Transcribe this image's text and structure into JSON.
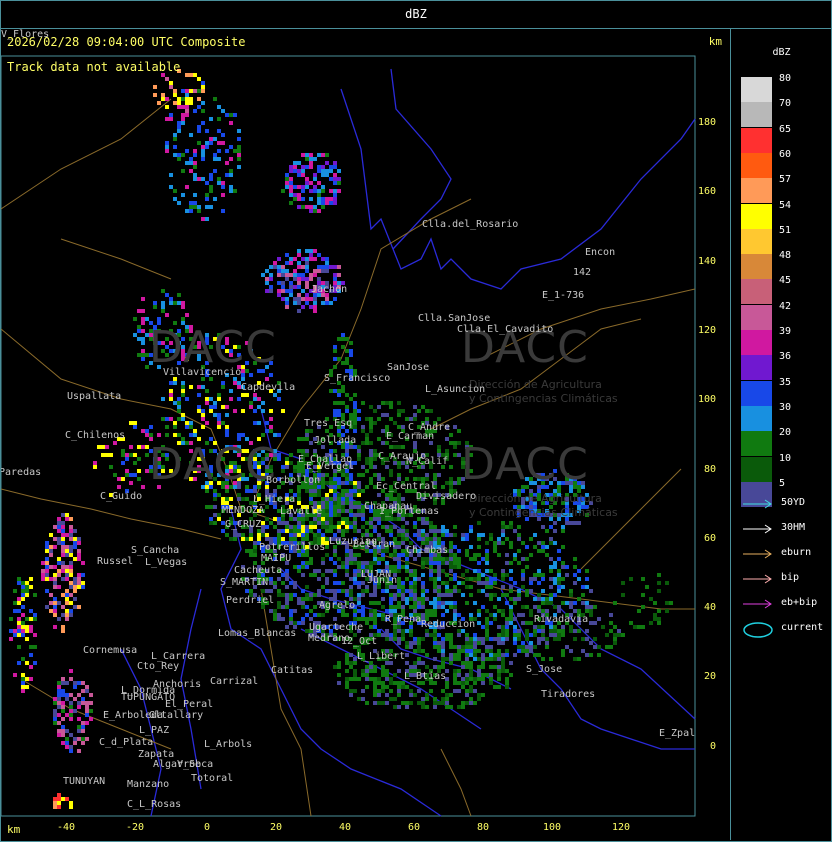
{
  "window": {
    "title": "dBZ"
  },
  "map": {
    "header": "2026/02/28 09:04:00 UTC Composite",
    "notice": "Track data not available",
    "km_label_top": "km",
    "km_label_bottom": "km",
    "y_ticks": [
      "180",
      "160",
      "140",
      "120",
      "100",
      "80",
      "60",
      "40",
      "20",
      "0"
    ],
    "x_ticks": [
      "-40",
      "-20",
      "0",
      "20",
      "40",
      "60",
      "80",
      "100",
      "120"
    ],
    "watermark_text": "DACC",
    "watermark_sub1": "Dirección de Agricultura",
    "watermark_sub2": "y Contingencias Climáticas",
    "places": [
      "Clla.del_Rosario",
      "Encon",
      "142",
      "E_1-736",
      "Clla.SanJose",
      "Clla.El_Cavadito",
      "Jachon",
      "Villavicencio",
      "Capdevila",
      "S_Francisco",
      "SanJose",
      "L_Asuncion",
      "Uspallata",
      "Tres Esq",
      "C_Andre",
      "E_Carman",
      "C_Chilenos",
      "Jollada",
      "C_Araujo",
      "N_Calif",
      "E_Vergel",
      "Borbollon",
      "Ec_Central",
      "Divisadero",
      "Paredas",
      "C_Guido",
      "L_Hiera",
      "MENDOZA",
      "Lavalle",
      "I_Portenas",
      "E_Challao",
      "Chapanau",
      "G_CRUZ",
      "Luzuriag",
      "Beltran",
      "Chimbas",
      "S_Cancha",
      "Potrerillos",
      "MAIPU",
      "Russel",
      "L_Vegas",
      "Cacheuta",
      "LUJAN",
      "Junin",
      "S_MARTIN",
      "Perdriel",
      "Agrelo",
      "R_Pena",
      "Rivadavia",
      "Lomas_Blancas",
      "Ugarteche",
      "Medrano",
      "Reduccion",
      "12_Oct",
      "L_Libert",
      "Cornemusa",
      "L_Carrera",
      "Cto_Rey",
      "S_Jose",
      "Catitas",
      "Carrizal",
      "Anchoris",
      "L_Btias",
      "Tiradores",
      "L_Dormida",
      "TUPUNGATO",
      "El_Peral",
      "E_Arboleda",
      "Gltallary",
      "E_Zpal",
      "L_PAZ",
      "C_d_Plata",
      "L_Arbols",
      "Zapata",
      "Algarrob",
      "V_Seca",
      "Totoral",
      "TUNUYAN",
      "Manzano",
      "C_L_Rosas",
      "V_Flores"
    ]
  },
  "legend": {
    "title": "dBZ",
    "scale": [
      {
        "label": "80",
        "color": "#d8d8d8"
      },
      {
        "label": "70",
        "color": "#b8b8b8"
      },
      {
        "label": "65",
        "color": "#ff3030"
      },
      {
        "label": "60",
        "color": "#ff5a10"
      },
      {
        "label": "57",
        "color": "#ff9a58"
      },
      {
        "label": "54",
        "color": "#ffff00"
      },
      {
        "label": "51",
        "color": "#ffc830"
      },
      {
        "label": "48",
        "color": "#d88838"
      },
      {
        "label": "45",
        "color": "#c86078"
      },
      {
        "label": "42",
        "color": "#c85898"
      },
      {
        "label": "39",
        "color": "#d018a0"
      },
      {
        "label": "36",
        "color": "#7018d0"
      },
      {
        "label": "35",
        "color": "#1848e8"
      },
      {
        "label": "30",
        "color": "#1890e0"
      },
      {
        "label": "20",
        "color": "#107a10"
      },
      {
        "label": "10",
        "color": "#0a5a0a"
      },
      {
        "label": "5",
        "color": "#484898"
      }
    ],
    "tracks": [
      {
        "label": "50YD",
        "color": "#40e0e0"
      },
      {
        "label": "30HM",
        "color": "#ffffff"
      },
      {
        "label": "eburn",
        "color": "#e8b060"
      },
      {
        "label": "bip",
        "color": "#ffb0b0"
      },
      {
        "label": "eb+bip",
        "color": "#e040e0"
      },
      {
        "label": "current",
        "color": "#20d0e0"
      }
    ]
  },
  "colors": {
    "accent": "#ffff66",
    "frame": "#4a8f9a",
    "border": "#2a2ad8",
    "road": "#8a6a2a"
  }
}
